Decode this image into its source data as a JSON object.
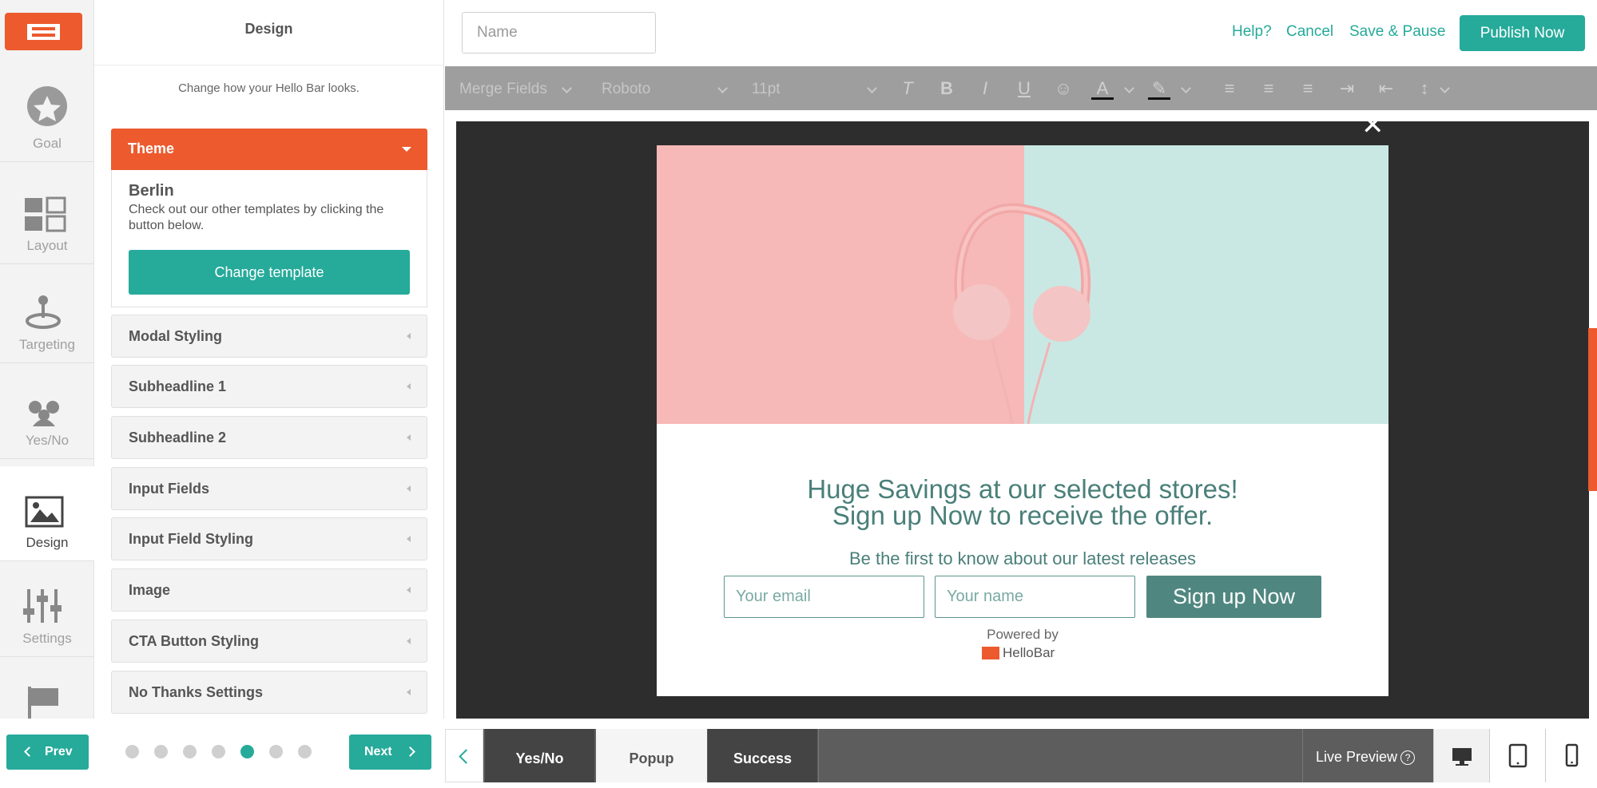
{
  "rail": {
    "items": [
      {
        "label": "Goal",
        "icon": "star-icon"
      },
      {
        "label": "Layout",
        "icon": "layout-icon"
      },
      {
        "label": "Targeting",
        "icon": "joystick-icon"
      },
      {
        "label": "Yes/No",
        "icon": "yes-no-person-icon"
      },
      {
        "label": "Design",
        "icon": "image-icon"
      },
      {
        "label": "Settings",
        "icon": "sliders-icon"
      },
      {
        "label": "",
        "icon": "flag-icon"
      }
    ],
    "active": "Design"
  },
  "panel": {
    "title": "Design",
    "subtitle": "Change how your Hello Bar looks.",
    "theme": {
      "header": "Theme",
      "name": "Berlin",
      "description": "Check out our other templates by clicking the button below.",
      "button": "Change template"
    },
    "sections": [
      "Modal Styling",
      "Subheadline 1",
      "Subheadline 2",
      "Input Fields",
      "Input Field Styling",
      "Image",
      "CTA Button Styling",
      "No Thanks Settings"
    ]
  },
  "nav": {
    "prev": "Prev",
    "next": "Next",
    "steps_total": 7,
    "step_current": 5
  },
  "topbar": {
    "name_placeholder": "Name",
    "help": "Help?",
    "cancel": "Cancel",
    "save_pause": "Save & Pause",
    "publish": "Publish Now"
  },
  "toolbar": {
    "merge_fields": "Merge Fields",
    "font": "Roboto",
    "size": "11pt",
    "tools": [
      "clear-format-icon",
      "bold-icon",
      "italic-icon",
      "underline-icon",
      "emoji-icon",
      "text-color-icon",
      "highlight-icon",
      "align-left-icon",
      "align-center-icon",
      "align-right-icon",
      "indent-icon",
      "outdent-icon",
      "line-height-icon"
    ]
  },
  "modal": {
    "headline_line1": "Huge Savings at our selected stores!",
    "headline_line2": "Sign up Now to receive the offer.",
    "subheadline": "Be the first to know about our latest releases",
    "email_placeholder": "Your email",
    "name_placeholder": "Your name",
    "cta": "Sign up Now",
    "powered_by": "Powered by",
    "brand": "HelloBar",
    "close": "✕"
  },
  "viewtabs": {
    "tabs": [
      "Yes/No",
      "Popup",
      "Success"
    ],
    "active": "Popup",
    "live_preview": "Live Preview",
    "devices": [
      "desktop-icon",
      "tablet-icon",
      "mobile-icon"
    ]
  },
  "colors": {
    "brand_orange": "#ec5a2e",
    "accent_teal": "#26aa9a",
    "modal_text": "#4a7f79"
  }
}
